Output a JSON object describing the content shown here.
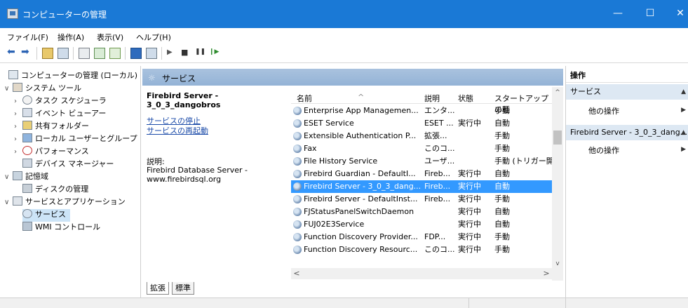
{
  "window": {
    "title": "コンピューターの管理",
    "controls": {
      "minimize": "—",
      "maximize": "☐",
      "close": "✕"
    }
  },
  "menu": [
    {
      "label": "ファイル(F)"
    },
    {
      "label": "操作(A)"
    },
    {
      "label": "表示(V)"
    },
    {
      "label": "ヘルプ(H)"
    }
  ],
  "toolbar": {
    "icons": [
      "back-icon",
      "forward-icon",
      "up-folder-icon",
      "show-hide-tree-icon",
      "properties-icon",
      "refresh-icon",
      "export-icon",
      "help-icon",
      "view-icon",
      "start-service-icon",
      "stop-service-icon",
      "pause-service-icon",
      "restart-service-icon"
    ],
    "glyphs": {
      "back": "⬅",
      "forward": "➡",
      "start": "▶",
      "stop": "■",
      "pause": "❚❚",
      "restart": "❙▶"
    }
  },
  "tree": {
    "nodes": [
      {
        "label": "コンピューターの管理 (ローカル)",
        "chev": ""
      },
      {
        "label": "システム ツール",
        "chev": "∨"
      },
      {
        "label": "タスク スケジューラ",
        "chev": "›"
      },
      {
        "label": "イベント ビューアー",
        "chev": "›"
      },
      {
        "label": "共有フォルダー",
        "chev": "›"
      },
      {
        "label": "ローカル ユーザーとグループ",
        "chev": "›"
      },
      {
        "label": "パフォーマンス",
        "chev": "›"
      },
      {
        "label": "デバイス マネージャー",
        "chev": ""
      },
      {
        "label": "記憶域",
        "chev": "∨"
      },
      {
        "label": "ディスクの管理",
        "chev": ""
      },
      {
        "label": "サービスとアプリケーション",
        "chev": "∨"
      },
      {
        "label": "サービス",
        "chev": ""
      },
      {
        "label": "WMI コントロール",
        "chev": ""
      }
    ]
  },
  "center": {
    "header_title": "サービス",
    "header_icon": "☼",
    "selected_service_name": "Firebird Server - 3_0_3_dangobros",
    "stop_link": "サービスの停止",
    "restart_link": "サービスの再起動",
    "desc_label": "説明:",
    "desc_text": "Firebird Database Server - www.firebirdsql.org",
    "tab_extended": "拡張",
    "tab_standard": "標準"
  },
  "grid": {
    "columns": {
      "name": "名前",
      "desc": "説明",
      "status": "状態",
      "startup": "スタートアップの種"
    },
    "sort_arrow": "^",
    "rows": [
      {
        "name": "Enterprise App Managemen...",
        "desc": "エンタ...",
        "status": "",
        "startup": "手動"
      },
      {
        "name": "ESET Service",
        "desc": "ESET ...",
        "status": "実行中",
        "startup": "自動"
      },
      {
        "name": "Extensible Authentication P...",
        "desc": "拡張...",
        "status": "",
        "startup": "手動"
      },
      {
        "name": "Fax",
        "desc": "このコ...",
        "status": "",
        "startup": "手動"
      },
      {
        "name": "File History Service",
        "desc": "ユーザ...",
        "status": "",
        "startup": "手動 (トリガー開"
      },
      {
        "name": "Firebird Guardian - DefaultI...",
        "desc": "Fireb...",
        "status": "実行中",
        "startup": "自動"
      },
      {
        "name": "Firebird Server - 3_0_3_dang...",
        "desc": "Fireb...",
        "status": "実行中",
        "startup": "自動"
      },
      {
        "name": "Firebird Server - DefaultInst...",
        "desc": "Fireb...",
        "status": "実行中",
        "startup": "手動"
      },
      {
        "name": "FJStatusPanelSwitchDaemon",
        "desc": "",
        "status": "実行中",
        "startup": "自動"
      },
      {
        "name": "FUJ02E3Service",
        "desc": "",
        "status": "実行中",
        "startup": "自動"
      },
      {
        "name": "Function Discovery Provider...",
        "desc": "FDP...",
        "status": "実行中",
        "startup": "手動"
      },
      {
        "name": "Function Discovery Resourc...",
        "desc": "このコ...",
        "status": "実行中",
        "startup": "手動"
      }
    ],
    "selected_index": 6,
    "scroll_up": "^",
    "scroll_down": "v",
    "scroll_left": "<",
    "scroll_right": ">"
  },
  "actions": {
    "header": "操作",
    "section1_title": "サービス",
    "section1_item": "他の操作",
    "section2_title": "Firebird Server - 3_0_3_dang...",
    "section2_item": "他の操作",
    "caret": "▲",
    "item_arrow": "▶"
  }
}
